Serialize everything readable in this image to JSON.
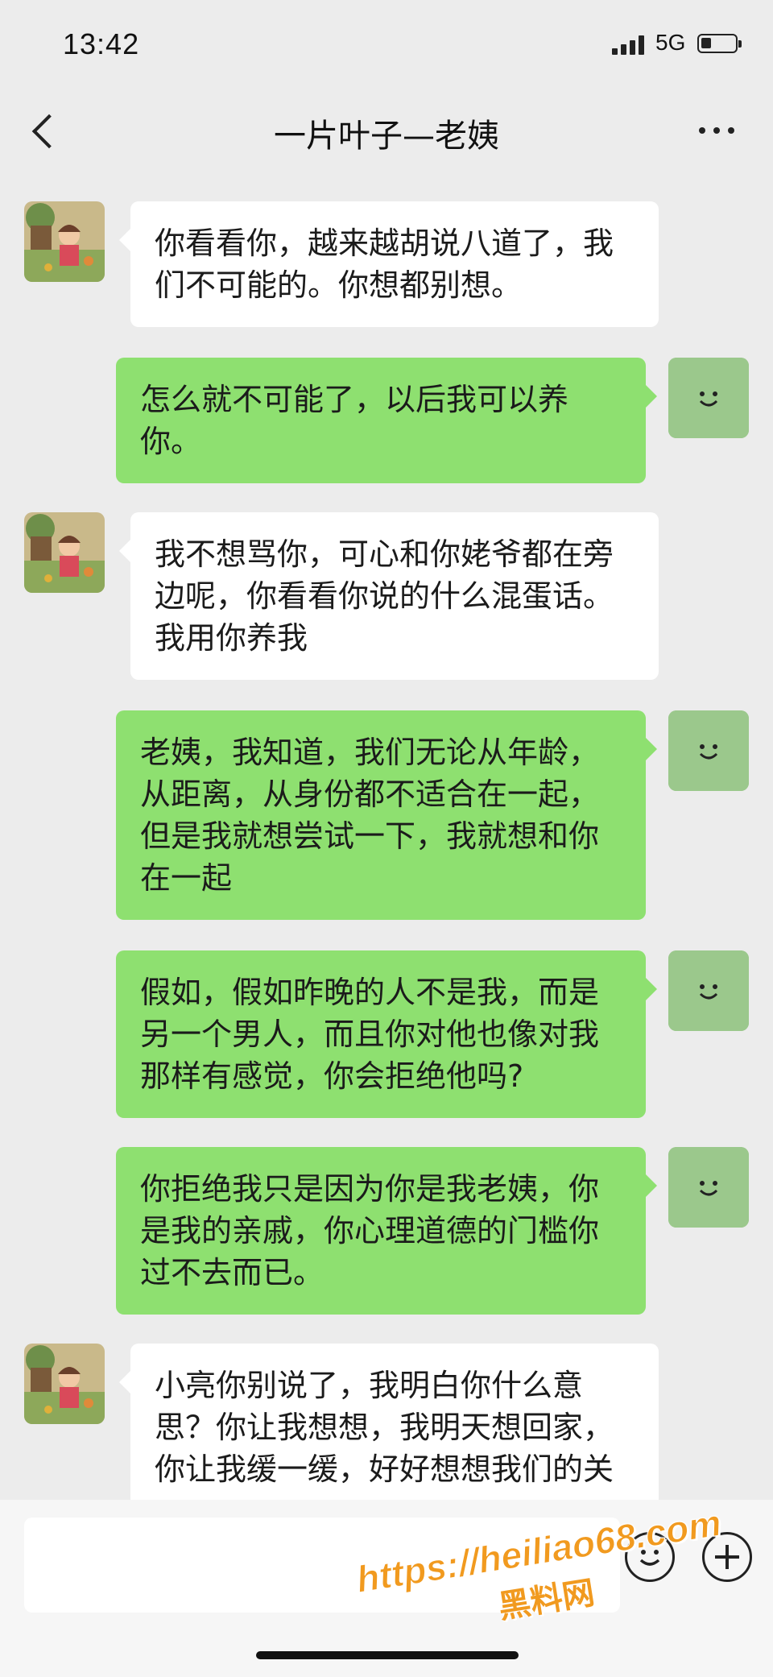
{
  "status_bar": {
    "time": "13:42",
    "network": "5G"
  },
  "header": {
    "title": "一片叶子—老姨"
  },
  "messages": [
    {
      "side": "in",
      "lines": [
        "你看看你，越来越胡说八道了，我",
        "们不可能的。你想都别想。"
      ]
    },
    {
      "side": "out",
      "lines": [
        "怎么就不可能了，以后我可以养",
        "你。"
      ]
    },
    {
      "side": "in",
      "lines": [
        "我不想骂你，可心和你姥爷都在旁",
        "边呢，你看看你说的什么混蛋话。",
        "我用你养我"
      ]
    },
    {
      "side": "out",
      "lines": [
        "老姨，我知道，我们无论从年龄，",
        "从距离，从身份都不适合在一起，",
        "但是我就想尝试一下，我就想和你",
        "在一起"
      ]
    },
    {
      "side": "out",
      "lines": [
        "假如，假如昨晚的人不是我，而是",
        "另一个男人，而且你对他也像对我",
        "那样有感觉，你会拒绝他吗?"
      ]
    },
    {
      "side": "out",
      "lines": [
        "你拒绝我只是因为你是我老姨，你",
        "是我的亲戚，你心理道德的门槛你",
        "过不去而已。"
      ]
    },
    {
      "side": "in",
      "lines": [
        "小亮你别说了，我明白你什么意",
        "思？你让我想想，我明天想回家，",
        "你让我缓一缓，好好想想我们的关"
      ]
    }
  ],
  "watermark": {
    "url": "https://heiliao68.com",
    "name": "黑料网"
  },
  "colors": {
    "outgoing_bubble": "#8ee070",
    "incoming_bubble": "#ffffff",
    "background": "#ececec",
    "watermark": "#f19a1f"
  },
  "icons": {
    "back": "chevron-left-icon",
    "more": "more-dots-icon",
    "emoji": "emoji-icon",
    "plus": "plus-circle-icon"
  }
}
